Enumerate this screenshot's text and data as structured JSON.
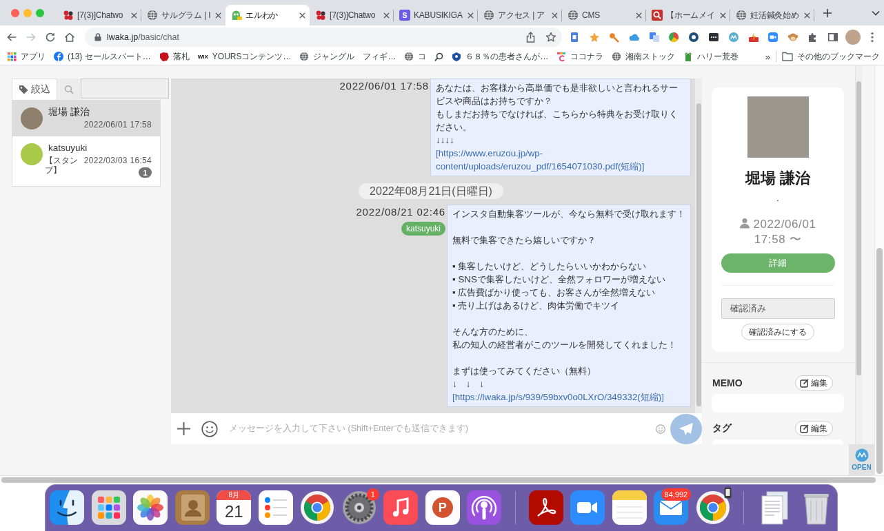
{
  "browser": {
    "tabs": [
      {
        "title": "[7(3)]Chatwo",
        "kind": "dots",
        "selected": false
      },
      {
        "title": "サルグラム | I",
        "kind": "globe",
        "selected": false
      },
      {
        "title": "エルわか",
        "kind": "mascot",
        "selected": true
      },
      {
        "title": "[7(3)]Chatwo",
        "kind": "dots",
        "selected": false
      },
      {
        "title": "KABUSIKIGA",
        "kind": "letter",
        "icon_text": "S",
        "selected": false
      },
      {
        "title": "アクセス | ア",
        "kind": "globe",
        "selected": false
      },
      {
        "title": "CMS",
        "kind": "globe",
        "selected": false
      },
      {
        "title": "【ホームメイ",
        "kind": "magnifier",
        "selected": false
      },
      {
        "title": "妊活鍼灸始め",
        "kind": "globe",
        "selected": false
      }
    ],
    "forward": {
      "disabled": true
    },
    "address": {
      "host": "lwaka.jp",
      "path": "/basic/chat"
    },
    "bookmarks": [
      {
        "label": "アプリ",
        "kind": "apps"
      },
      {
        "label": "(13) セールスパート…",
        "kind": "facebook"
      },
      {
        "label": "落札",
        "kind": "auction"
      },
      {
        "label": "YOURSコンテンツ…",
        "kind": "wix",
        "icon_text": "WIX"
      },
      {
        "label": "ジャングル",
        "kind": "globe"
      },
      {
        "label": "フィギ…",
        "kind": "plain"
      },
      {
        "label": "コ",
        "kind": "globe"
      },
      {
        "kind": "search"
      },
      {
        "label": "６８％の患者さんが…",
        "kind": "shield"
      },
      {
        "label": "ココナラ",
        "kind": "stripes"
      },
      {
        "label": "湘南ストック",
        "kind": "globe"
      },
      {
        "label": "ハリー荒巻",
        "kind": "frog"
      }
    ],
    "bookmarks_overflow": "»",
    "other_bookmarks": "その他のブックマーク"
  },
  "sidebar": {
    "filter_tab": "絞込",
    "conversations": [
      {
        "name": "堀場 謙治",
        "time": "2022/06/01 17:58",
        "selected": true
      },
      {
        "name": "katsuyuki",
        "preview": "【スタンプ】",
        "time": "2022/03/03 16:54",
        "unread": "1",
        "selected": false
      }
    ]
  },
  "chat": {
    "items": [
      {
        "kind": "message",
        "time": "2022/06/01 17:58",
        "paragraphs": [
          {
            "lines": [
              "あなたは、お客様から高単価でも是非欲しいと言われるサービスや商品はお持ちですか？",
              "もしまだお持ちでなければ、こちらから特典をお受け取りください。",
              "↓↓↓↓"
            ]
          }
        ],
        "link": "[https://www.eruzou.jp/wp-content/uploads/eruzou_pdf/1654071030.pdf(短縮)]"
      },
      {
        "kind": "date",
        "label": "2022年08月21日(日曜日)"
      },
      {
        "kind": "message",
        "time": "2022/08/21 02:46",
        "sender": "katsuyuki",
        "paragraphs": [
          {
            "lines": [
              "インスタ自動集客ツールが、今なら無料で受け取れます！"
            ]
          },
          {
            "lines": [
              "無料で集客できたら嬉しいですか？"
            ]
          },
          {
            "lines": [
              "▪ 集客したいけど、どうしたらいいかわからない",
              "▪ SNSで集客したいけど、全然フォロワーが増えない",
              "▪ 広告費ばかり使っても、お客さんが全然増えない",
              "▪ 売り上げはあるけど、肉体労働でキツイ"
            ]
          },
          {
            "lines": [
              "そんな方のために、",
              "私の知人の経営者がこのツールを開発してくれました！"
            ]
          },
          {
            "lines": [
              "まずは使ってみてください（無料）",
              "↓　↓　↓"
            ]
          }
        ],
        "link": "[https://lwaka.jp/s/939/59bxv0o0LXrO/349332(短縮)]"
      }
    ],
    "composer": {
      "placeholder": "メッセージを入力して下さい (Shift+Enterでも送信できます)"
    }
  },
  "profile": {
    "name": "堀場 謙治",
    "status_message": ".",
    "since": "2022/06/01 17:58 〜",
    "detail_button": "詳細",
    "status_field": "確認済み",
    "confirm_button": "確認済みにする"
  },
  "memo": {
    "title": "MEMO",
    "edit_button": "編集"
  },
  "tags": {
    "title": "タグ",
    "edit_button": "編集"
  },
  "widget": {
    "label": "OPEN"
  },
  "dock": {
    "items": [
      {
        "kind": "finder"
      },
      {
        "kind": "launchpad"
      },
      {
        "kind": "photos"
      },
      {
        "kind": "contacts"
      },
      {
        "kind": "calendar",
        "month": "8月",
        "day": "21"
      },
      {
        "kind": "reminders"
      },
      {
        "kind": "chrome",
        "handoff": false
      },
      {
        "kind": "settings",
        "badge": "1"
      },
      {
        "kind": "music"
      },
      {
        "kind": "powerpoint",
        "icon_text": "P"
      },
      {
        "kind": "podcasts"
      },
      {
        "kind": "divider"
      },
      {
        "kind": "acrobat"
      },
      {
        "kind": "zoom"
      },
      {
        "kind": "notes"
      },
      {
        "kind": "mail",
        "badge": "84,992"
      },
      {
        "kind": "chrome",
        "handoff": true
      },
      {
        "kind": "divider"
      },
      {
        "kind": "documents"
      },
      {
        "kind": "trash"
      }
    ]
  }
}
